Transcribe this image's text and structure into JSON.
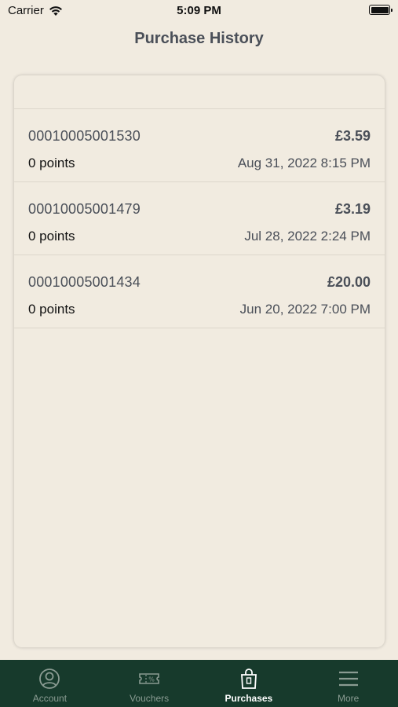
{
  "status_bar": {
    "carrier": "Carrier",
    "time": "5:09 PM"
  },
  "header": {
    "title": "Purchase History"
  },
  "purchases": [
    {
      "id": "00010005001530",
      "amount": "£3.59",
      "points": "0 points",
      "date": "Aug 31, 2022 8:15 PM"
    },
    {
      "id": "00010005001479",
      "amount": "£3.19",
      "points": "0 points",
      "date": "Jul 28, 2022 2:24 PM"
    },
    {
      "id": "00010005001434",
      "amount": "£20.00",
      "points": "0 points",
      "date": "Jun 20, 2022 7:00 PM"
    }
  ],
  "tab_bar": {
    "tabs": [
      {
        "label": "Account",
        "icon": "account-icon",
        "active": false
      },
      {
        "label": "Vouchers",
        "icon": "voucher-icon",
        "active": false
      },
      {
        "label": "Purchases",
        "icon": "shopping-bag-icon",
        "active": true
      },
      {
        "label": "More",
        "icon": "menu-icon",
        "active": false
      }
    ]
  },
  "colors": {
    "background": "#f1ebe0",
    "tab_bar": "#173a2c",
    "title": "#4a4f58"
  }
}
